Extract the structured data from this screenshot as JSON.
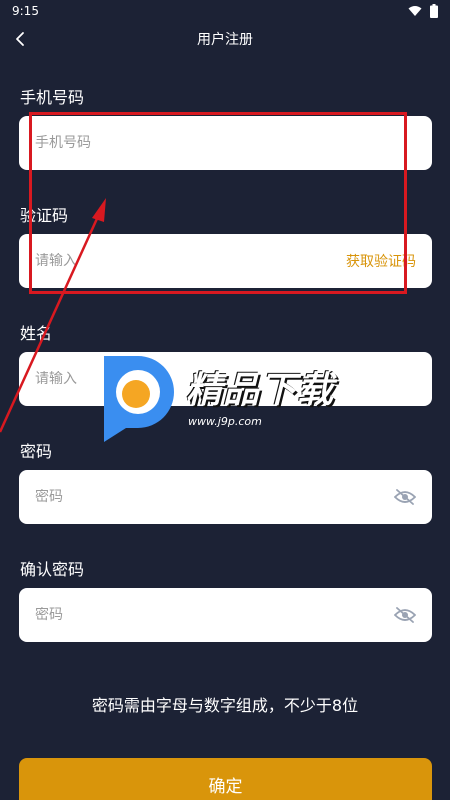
{
  "status_bar": {
    "time": "9:15"
  },
  "header": {
    "title": "用户注册"
  },
  "form": {
    "phone": {
      "label": "手机号码",
      "placeholder": "手机号码"
    },
    "code": {
      "label": "验证码",
      "placeholder": "请输入",
      "action": "获取验证码"
    },
    "name": {
      "label": "姓名",
      "placeholder": "请输入"
    },
    "password": {
      "label": "密码",
      "placeholder": "密码"
    },
    "confirm_password": {
      "label": "确认密码",
      "placeholder": "密码"
    }
  },
  "hint": "密码需由字母与数字组成，不少于8位",
  "submit_label": "确定",
  "watermark": {
    "brand": "精品下载",
    "url": "www.j9p.com"
  },
  "colors": {
    "background": "#1c2235",
    "accent": "#d9950b",
    "annotation": "#d81920"
  }
}
